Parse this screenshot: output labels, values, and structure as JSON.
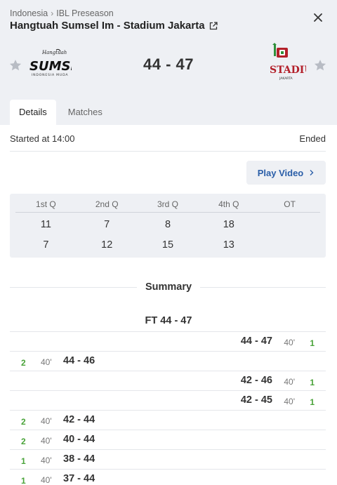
{
  "header": {
    "breadcrumb": {
      "country": "Indonesia",
      "competition": "IBL Preseason"
    },
    "title": "Hangtuah Sumsel Im - Stadium Jakarta",
    "home_team": {
      "logo": {
        "wordmark": "SUMSEL",
        "top_script": "Hangtuah",
        "tagline": "INDONESIA MUDA"
      }
    },
    "away_team": {
      "logo": {
        "wordmark": "STADIUM",
        "tagline": "JAKARTA"
      }
    },
    "score": "44 - 47"
  },
  "tabs": [
    {
      "label": "Details",
      "active": true
    },
    {
      "label": "Matches",
      "active": false
    }
  ],
  "status": {
    "started": "Started at 14:00",
    "state": "Ended"
  },
  "play_video": {
    "label": "Play Video"
  },
  "quarters": {
    "headers": [
      "1st Q",
      "2nd Q",
      "3rd Q",
      "4th Q",
      "OT"
    ],
    "home": [
      "11",
      "7",
      "8",
      "18",
      ""
    ],
    "away": [
      "7",
      "12",
      "15",
      "13",
      ""
    ]
  },
  "summary": {
    "label": "Summary",
    "final": "FT 44 - 47",
    "events": [
      {
        "side": "away",
        "score": "44 - 47",
        "minute": "40'",
        "points": "1"
      },
      {
        "side": "home",
        "score": "44 - 46",
        "minute": "40'",
        "points": "2"
      },
      {
        "side": "away",
        "score": "42 - 46",
        "minute": "40'",
        "points": "1"
      },
      {
        "side": "away",
        "score": "42 - 45",
        "minute": "40'",
        "points": "1"
      },
      {
        "side": "home",
        "score": "42 - 44",
        "minute": "40'",
        "points": "2"
      },
      {
        "side": "home",
        "score": "40 - 44",
        "minute": "40'",
        "points": "2"
      },
      {
        "side": "home",
        "score": "38 - 44",
        "minute": "40'",
        "points": "1"
      },
      {
        "side": "home",
        "score": "37 - 44",
        "minute": "40'",
        "points": "1"
      }
    ]
  },
  "colors": {
    "points": "#4aa33a",
    "link": "#2a5ea8",
    "header_bg": "#eef0f4",
    "away_logo_red": "#b3202a",
    "away_logo_green": "#2f8f3a"
  },
  "icons": {
    "close": "close-icon",
    "star": "star-icon",
    "external": "external-link-icon",
    "chevron": "chevron-right-icon"
  }
}
